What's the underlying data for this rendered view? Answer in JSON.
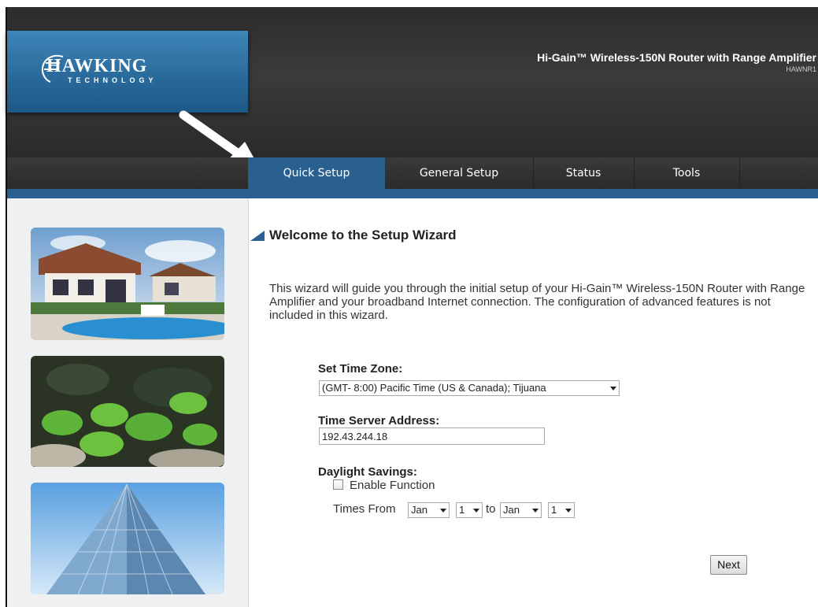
{
  "header": {
    "logo_text": "HAWKING",
    "logo_sub": "TECHNOLOGY",
    "product_title": "Hi-Gain™ Wireless-150N Router with Range Amplifier",
    "product_model": "HAWNR1"
  },
  "nav": {
    "items": [
      {
        "label": "Quick Setup",
        "active": true
      },
      {
        "label": "General Setup",
        "active": false
      },
      {
        "label": "Status",
        "active": false
      },
      {
        "label": "Tools",
        "active": false
      }
    ]
  },
  "sidebar": {
    "images": [
      "house-photo",
      "pond-photo",
      "building-photo"
    ]
  },
  "wizard": {
    "title": "Welcome to the Setup Wizard",
    "description": "This wizard will guide you through the initial setup of your Hi-Gain™ Wireless-150N Router with Range Amplifier and your broadband Internet connection. The configuration of advanced features is not included in this wizard.",
    "timezone_label": "Set Time Zone:",
    "timezone_value": "(GMT- 8:00) Pacific Time (US & Canada); Tijuana",
    "timeserver_label": "Time Server Address:",
    "timeserver_value": "192.43.244.18",
    "daylight_label": "Daylight Savings:",
    "enable_label": "Enable Function",
    "enable_checked": false,
    "times_from_label": "Times From",
    "from_month": "Jan",
    "from_day": "1",
    "to_label": "to",
    "to_month": "Jan",
    "to_day": "1",
    "next_label": "Next"
  },
  "colors": {
    "accent": "#2a6090",
    "header_bg": "#333333",
    "logo_bg": "#2a6b9c"
  }
}
